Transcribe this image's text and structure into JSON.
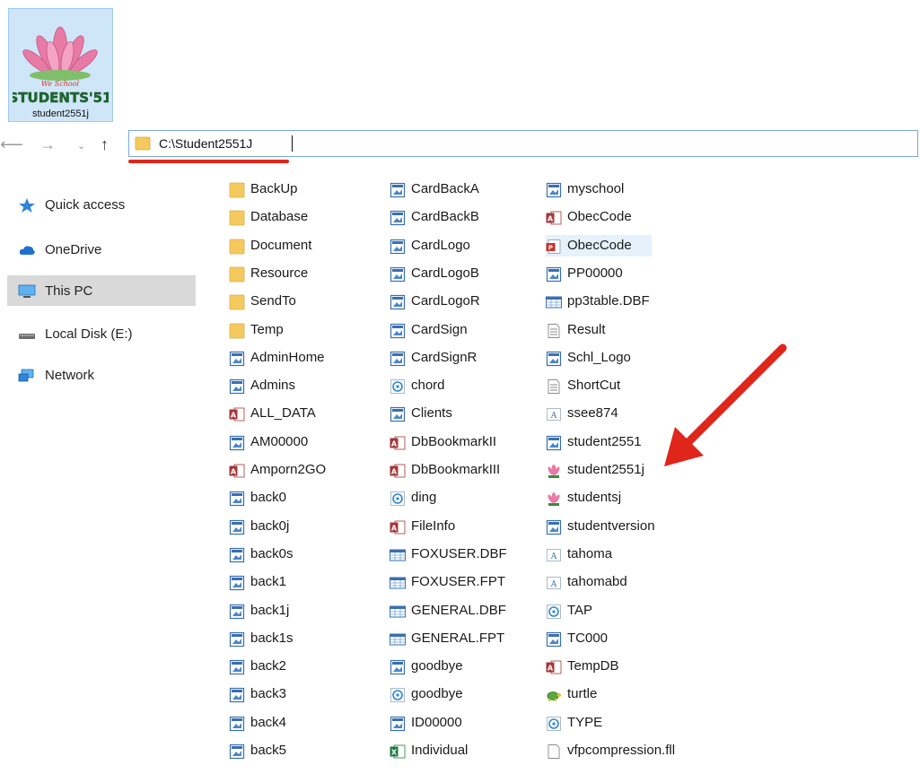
{
  "desktop_icon": {
    "caption": "student2551j",
    "logo_text": "STUDENTS'51",
    "logo_subtext": "We School"
  },
  "address": {
    "path": "C:\\Student2551J"
  },
  "sidebar": {
    "items": [
      {
        "label": "Quick access",
        "icon": "star-icon"
      },
      {
        "label": "OneDrive",
        "icon": "cloud-icon"
      },
      {
        "label": "This PC",
        "icon": "monitor-icon",
        "selected": true
      },
      {
        "label": "Local Disk (E:)",
        "icon": "drive-icon"
      },
      {
        "label": "Network",
        "icon": "network-icon"
      }
    ]
  },
  "columns": [
    [
      {
        "name": "BackUp",
        "icon": "folder"
      },
      {
        "name": "Database",
        "icon": "folder"
      },
      {
        "name": "Document",
        "icon": "folder"
      },
      {
        "name": "Resource",
        "icon": "folder"
      },
      {
        "name": "SendTo",
        "icon": "folder"
      },
      {
        "name": "Temp",
        "icon": "folder"
      },
      {
        "name": "AdminHome",
        "icon": "form"
      },
      {
        "name": "Admins",
        "icon": "form"
      },
      {
        "name": "ALL_DATA",
        "icon": "access"
      },
      {
        "name": "AM00000",
        "icon": "form"
      },
      {
        "name": "Amporn2GO",
        "icon": "access"
      },
      {
        "name": "back0",
        "icon": "form"
      },
      {
        "name": "back0j",
        "icon": "form"
      },
      {
        "name": "back0s",
        "icon": "form"
      },
      {
        "name": "back1",
        "icon": "form"
      },
      {
        "name": "back1j",
        "icon": "form"
      },
      {
        "name": "back1s",
        "icon": "form"
      },
      {
        "name": "back2",
        "icon": "form"
      },
      {
        "name": "back3",
        "icon": "form"
      },
      {
        "name": "back4",
        "icon": "form"
      },
      {
        "name": "back5",
        "icon": "form"
      }
    ],
    [
      {
        "name": "CardBackA",
        "icon": "form"
      },
      {
        "name": "CardBackB",
        "icon": "form"
      },
      {
        "name": "CardLogo",
        "icon": "form"
      },
      {
        "name": "CardLogoB",
        "icon": "form"
      },
      {
        "name": "CardLogoR",
        "icon": "form"
      },
      {
        "name": "CardSign",
        "icon": "form"
      },
      {
        "name": "CardSignR",
        "icon": "form"
      },
      {
        "name": "chord",
        "icon": "audio"
      },
      {
        "name": "Clients",
        "icon": "form"
      },
      {
        "name": "DbBookmarkII",
        "icon": "access"
      },
      {
        "name": "DbBookmarkIII",
        "icon": "access"
      },
      {
        "name": "ding",
        "icon": "audio"
      },
      {
        "name": "FileInfo",
        "icon": "access"
      },
      {
        "name": "FOXUSER.DBF",
        "icon": "table"
      },
      {
        "name": "FOXUSER.FPT",
        "icon": "table"
      },
      {
        "name": "GENERAL.DBF",
        "icon": "table"
      },
      {
        "name": "GENERAL.FPT",
        "icon": "table"
      },
      {
        "name": "goodbye",
        "icon": "form"
      },
      {
        "name": "goodbye",
        "icon": "audio"
      },
      {
        "name": "ID00000",
        "icon": "form"
      },
      {
        "name": "Individual",
        "icon": "excel"
      }
    ],
    [
      {
        "name": "myschool",
        "icon": "form"
      },
      {
        "name": "ObecCode",
        "icon": "access"
      },
      {
        "name": "ObecCode",
        "icon": "pdf",
        "highlighted": true
      },
      {
        "name": "PP00000",
        "icon": "form"
      },
      {
        "name": "pp3table.DBF",
        "icon": "table"
      },
      {
        "name": "Result",
        "icon": "text"
      },
      {
        "name": "Schl_Logo",
        "icon": "form"
      },
      {
        "name": "ShortCut",
        "icon": "text"
      },
      {
        "name": "ssee874",
        "icon": "font"
      },
      {
        "name": "student2551",
        "icon": "form"
      },
      {
        "name": "student2551j",
        "icon": "lotus"
      },
      {
        "name": "studentsj",
        "icon": "lotus"
      },
      {
        "name": "studentversion",
        "icon": "form"
      },
      {
        "name": "tahoma",
        "icon": "font"
      },
      {
        "name": "tahomabd",
        "icon": "font"
      },
      {
        "name": "TAP",
        "icon": "audio"
      },
      {
        "name": "TC000",
        "icon": "form"
      },
      {
        "name": "TempDB",
        "icon": "access"
      },
      {
        "name": "turtle",
        "icon": "turtle"
      },
      {
        "name": "TYPE",
        "icon": "audio"
      },
      {
        "name": "vfpcompression.fll",
        "icon": "blank"
      }
    ]
  ],
  "colors": {
    "accent": "#e0251b",
    "selection": "#d9d9d9",
    "folder": "#f5c95e"
  }
}
